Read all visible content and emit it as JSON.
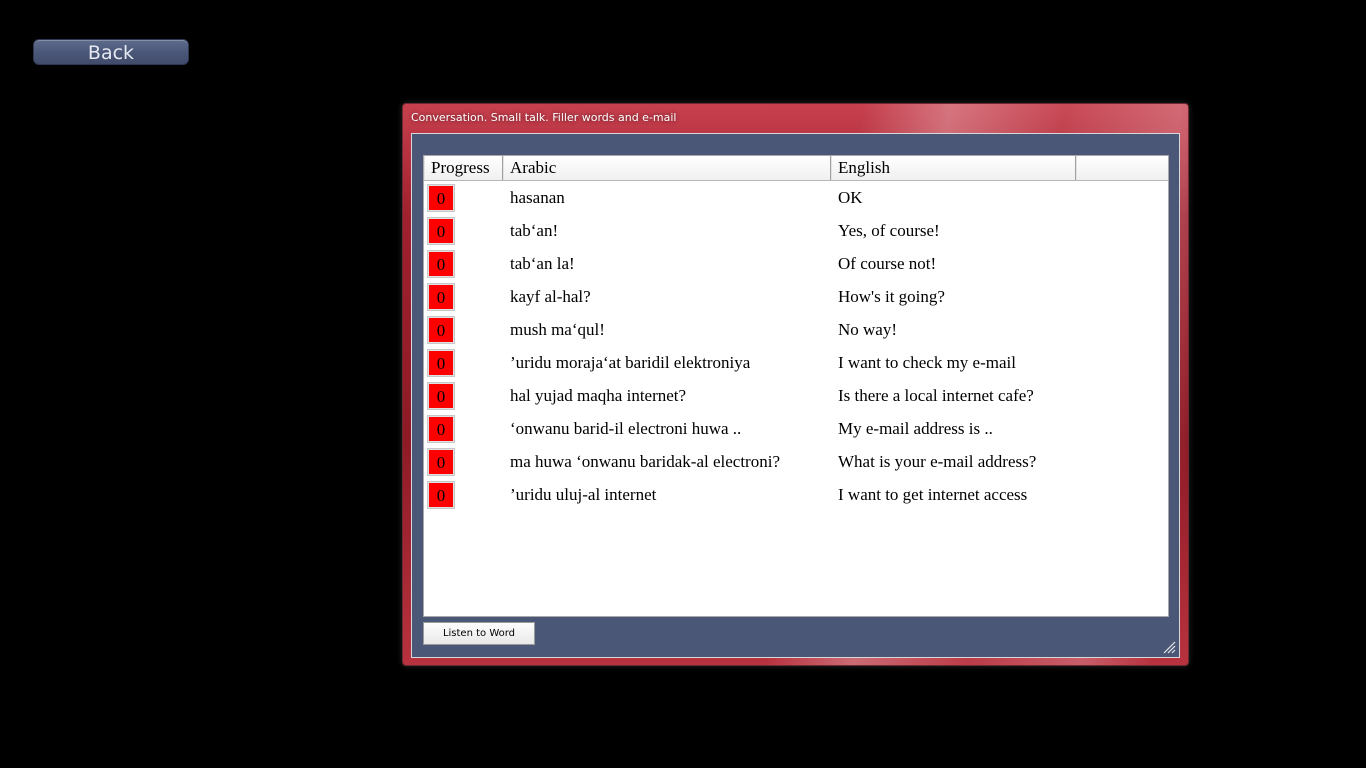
{
  "back_button": {
    "label": "Back"
  },
  "window": {
    "title": "Conversation. Small talk. Filler words and e-mail",
    "columns": [
      "Progress",
      "Arabic",
      "English",
      ""
    ],
    "rows": [
      {
        "progress": "0",
        "arabic": "hasanan",
        "english": "OK"
      },
      {
        "progress": "0",
        "arabic": "tab‘an!",
        "english": "Yes, of course!"
      },
      {
        "progress": "0",
        "arabic": "tab‘an la!",
        "english": "Of course not!"
      },
      {
        "progress": "0",
        "arabic": "kayf al-hal?",
        "english": "How's it going?"
      },
      {
        "progress": "0",
        "arabic": "mush ma‘qul!",
        "english": "No way!"
      },
      {
        "progress": "0",
        "arabic": "’uridu moraja‘at baridil elektroniya",
        "english": "I want to check my e-mail"
      },
      {
        "progress": "0",
        "arabic": "hal yujad maqha internet?",
        "english": "Is there a local internet cafe?"
      },
      {
        "progress": "0",
        "arabic": "‘onwanu barid-il electroni huwa ..",
        "english": "My e-mail address is .."
      },
      {
        "progress": "0",
        "arabic": "ma huwa ‘onwanu baridak-al electroni?",
        "english": "What is your e-mail address?"
      },
      {
        "progress": "0",
        "arabic": "’uridu uluj-al internet",
        "english": "I want to get internet access"
      }
    ],
    "listen_button": {
      "label": "Listen to Word"
    }
  },
  "colors": {
    "progress_badge": "#ff0000",
    "window_frame": "#a0202e",
    "client_background": "#4a5777"
  }
}
